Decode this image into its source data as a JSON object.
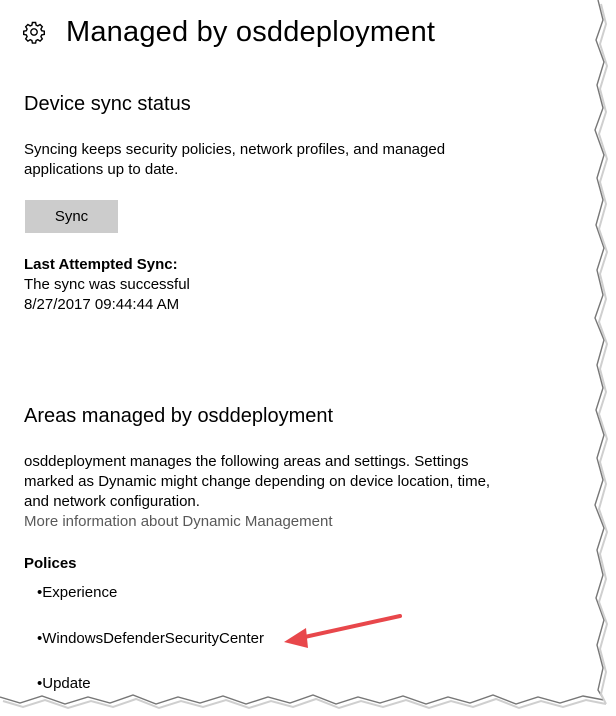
{
  "header": {
    "icon": "gear-icon",
    "title": "Managed by osddeployment"
  },
  "device_sync": {
    "heading": "Device sync status",
    "description": "Syncing keeps security policies, network profiles, and managed applications up to date.",
    "sync_button_label": "Sync",
    "last_attempted_label": "Last Attempted Sync:",
    "status_text": "The sync was successful",
    "timestamp": "8/27/2017 09:44:44 AM"
  },
  "areas": {
    "heading": "Areas managed by osddeployment",
    "description": "osddeployment manages the following areas and settings. Settings marked as Dynamic might change depending on device location, time, and network configuration.",
    "more_info_link": "More information about Dynamic Management",
    "policies_heading": "Polices",
    "policies": [
      "•Experience",
      "•WindowsDefenderSecurityCenter",
      "•Update"
    ]
  },
  "colors": {
    "link": "#595959",
    "button_bg": "#cccccc",
    "annotation_arrow": "#e8474b"
  }
}
